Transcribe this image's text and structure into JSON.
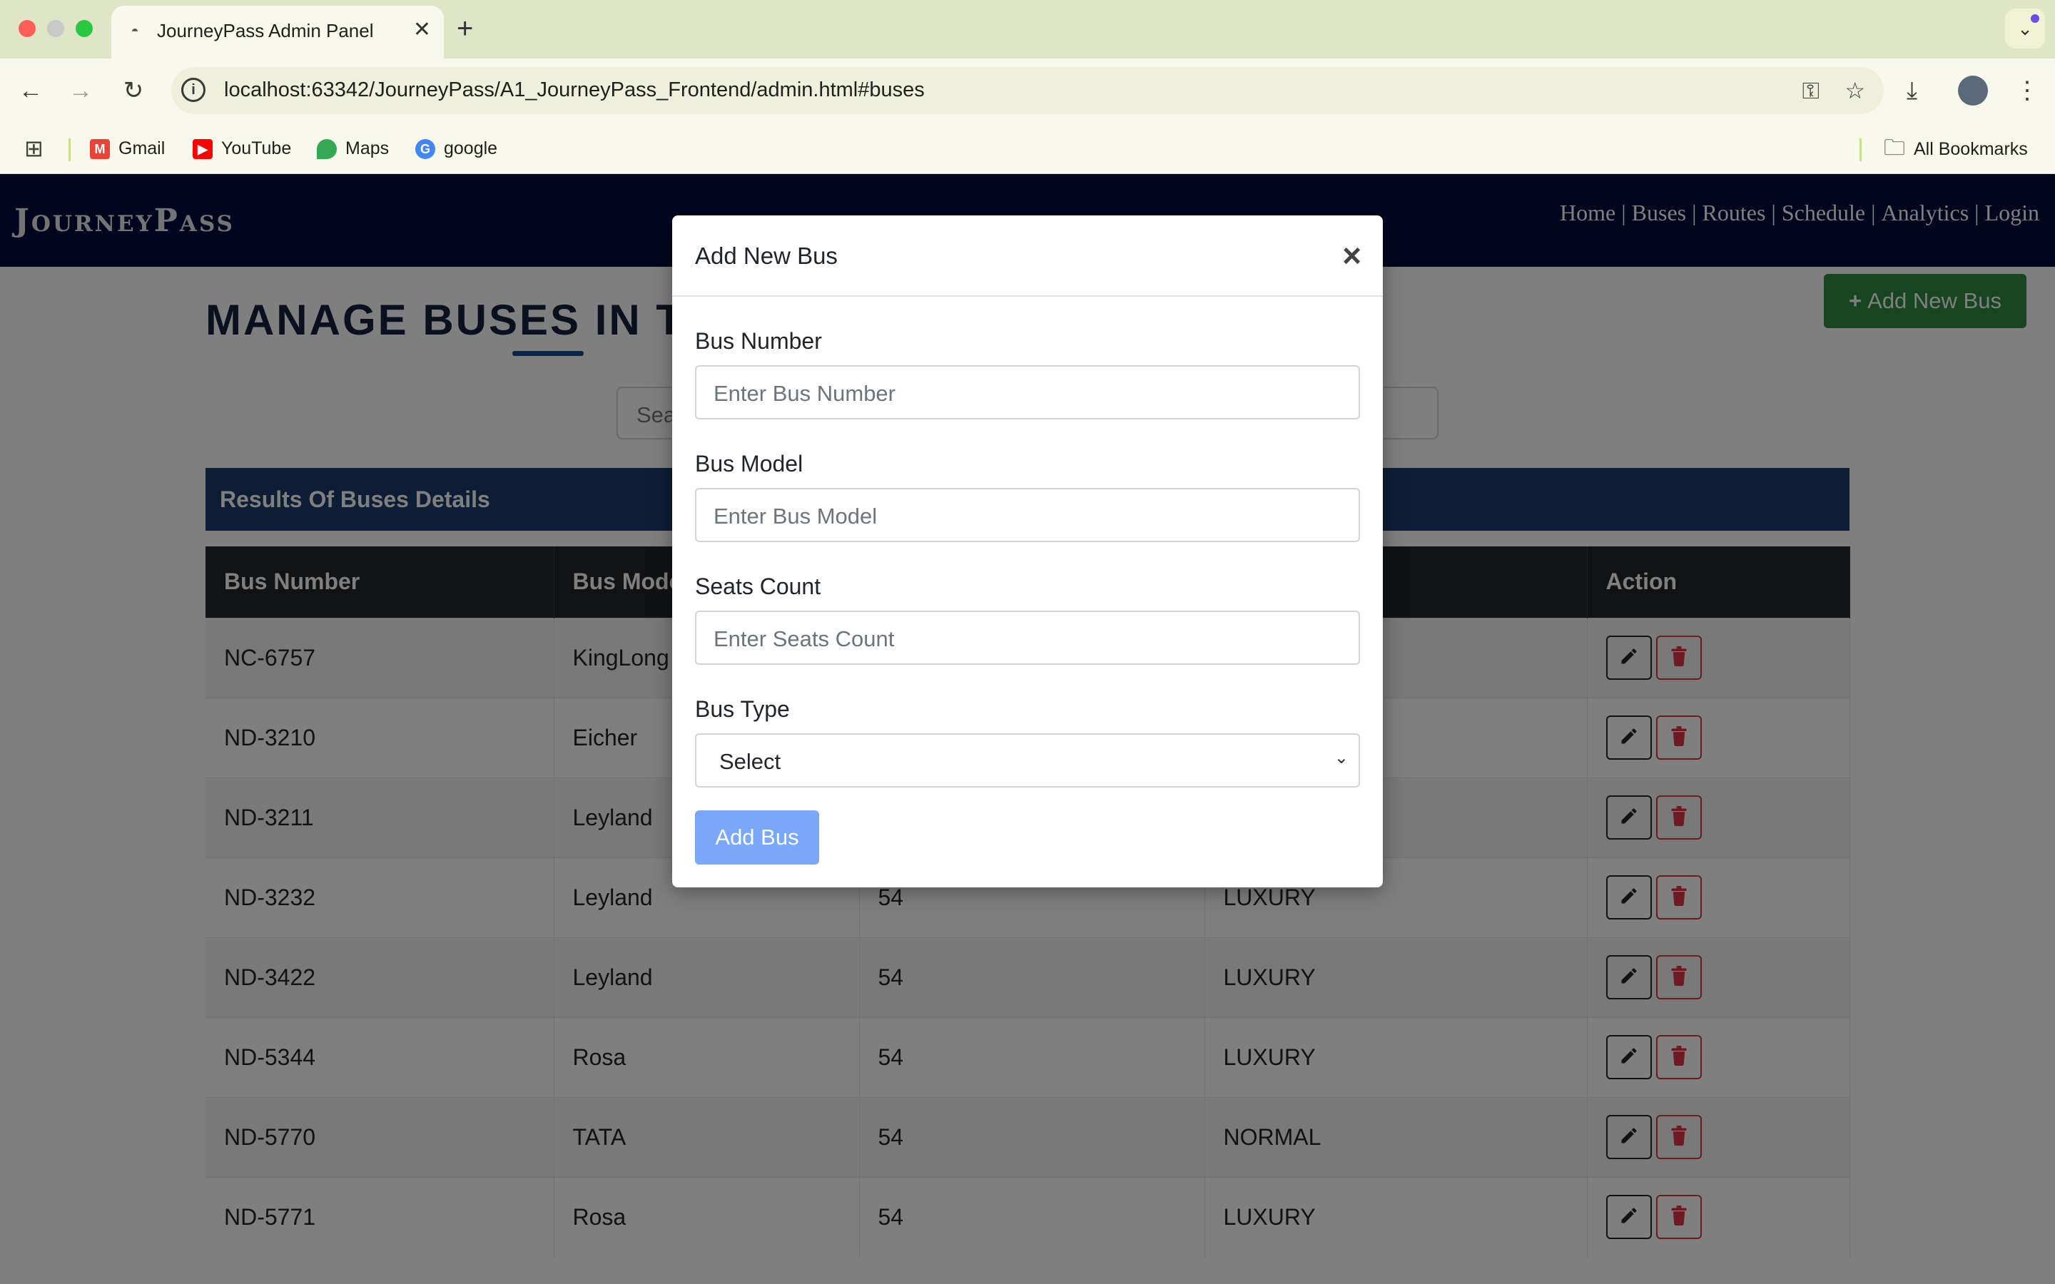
{
  "browser": {
    "tab_title": "JourneyPass Admin Panel",
    "url": "localhost:63342/JourneyPass/A1_JourneyPass_Frontend/admin.html#buses",
    "bookmarks": [
      "Gmail",
      "YouTube",
      "Maps",
      "google"
    ],
    "all_bookmarks": "All Bookmarks"
  },
  "site": {
    "logo": "JourneyPass",
    "nav": [
      "Home",
      "Buses",
      "Routes",
      "Schedule",
      "Analytics",
      "Login"
    ],
    "nav_separator": "|"
  },
  "page": {
    "title": "MANAGE BUSES IN TH",
    "add_button": "Add New Bus",
    "search_placeholder": "Sea",
    "results_title": "Results Of Buses Details"
  },
  "table": {
    "columns": [
      "Bus Number",
      "Bus Mode",
      "",
      "",
      "Action"
    ],
    "rows": [
      [
        "NC-6757",
        "KingLong",
        "",
        ""
      ],
      [
        "ND-3210",
        "Eicher",
        "",
        ""
      ],
      [
        "ND-3211",
        "Leyland",
        "",
        ""
      ],
      [
        "ND-3232",
        "Leyland",
        "54",
        "LUXURY"
      ],
      [
        "ND-3422",
        "Leyland",
        "54",
        "LUXURY"
      ],
      [
        "ND-5344",
        "Rosa",
        "54",
        "LUXURY"
      ],
      [
        "ND-5770",
        "TATA",
        "54",
        "NORMAL"
      ],
      [
        "ND-5771",
        "Rosa",
        "54",
        "LUXURY"
      ]
    ]
  },
  "modal": {
    "title": "Add New Bus",
    "close": "×",
    "fields": [
      {
        "label": "Bus Number",
        "placeholder": "Enter Bus Number"
      },
      {
        "label": "Bus Model",
        "placeholder": "Enter Bus Model"
      },
      {
        "label": "Seats Count",
        "placeholder": "Enter Seats Count"
      }
    ],
    "bus_type_label": "Bus Type",
    "bus_type_value": "Select",
    "submit": "Add Bus"
  },
  "colors": {
    "navbar": "#050b3c",
    "add_button": "#2e8b3e",
    "results_bar": "#1b3a6b",
    "submit_button": "#7aa7f7"
  }
}
